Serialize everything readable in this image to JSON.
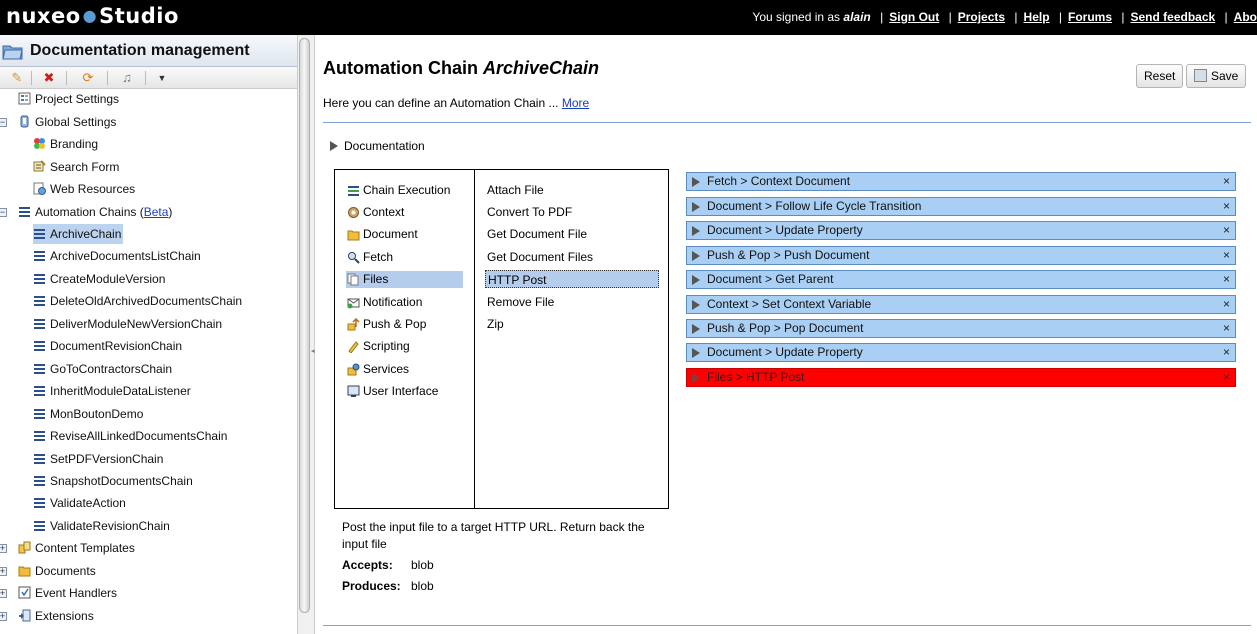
{
  "topbar": {
    "logo_left": "nuxeo",
    "logo_right": "Studio",
    "signed_in_prefix": "You signed in as",
    "username": "alain",
    "links": [
      "Sign Out",
      "Projects",
      "Help",
      "Forums",
      "Send feedback",
      "Abo"
    ]
  },
  "sidebar": {
    "title": "Documentation management",
    "toolbar": [
      "add-icon",
      "delete-icon",
      "refresh-icon",
      "rename-icon",
      "dropdown-icon"
    ],
    "tree": [
      {
        "label": "Project Settings",
        "level": 1,
        "icon": "settings-icon"
      },
      {
        "label": "Global Settings",
        "level": 1,
        "expander": "⊟",
        "icon": "globe-icon"
      },
      {
        "label": "Branding",
        "level": 2,
        "icon": "branding-icon"
      },
      {
        "label": "Search Form",
        "level": 2,
        "icon": "search-form-icon"
      },
      {
        "label": "Web Resources",
        "level": 2,
        "icon": "web-resources-icon"
      },
      {
        "label": "Automation Chains (",
        "link": "Beta",
        "suffix": ")",
        "level": 1,
        "expander": "⊟",
        "icon": "chain-icon"
      },
      {
        "label": "ArchiveChain",
        "level": 2,
        "icon": "chain-icon",
        "selected": true
      },
      {
        "label": "ArchiveDocumentsListChain",
        "level": 2,
        "icon": "chain-icon"
      },
      {
        "label": "CreateModuleVersion",
        "level": 2,
        "icon": "chain-icon"
      },
      {
        "label": "DeleteOldArchivedDocumentsChain",
        "level": 2,
        "icon": "chain-icon"
      },
      {
        "label": "DeliverModuleNewVersionChain",
        "level": 2,
        "icon": "chain-icon"
      },
      {
        "label": "DocumentRevisionChain",
        "level": 2,
        "icon": "chain-icon"
      },
      {
        "label": "GoToContractorsChain",
        "level": 2,
        "icon": "chain-icon"
      },
      {
        "label": "InheritModuleDataListener",
        "level": 2,
        "icon": "chain-icon"
      },
      {
        "label": "MonBoutonDemo",
        "level": 2,
        "icon": "chain-icon"
      },
      {
        "label": "ReviseAllLinkedDocumentsChain",
        "level": 2,
        "icon": "chain-icon"
      },
      {
        "label": "SetPDFVersionChain",
        "level": 2,
        "icon": "chain-icon"
      },
      {
        "label": "SnapshotDocumentsChain",
        "level": 2,
        "icon": "chain-icon"
      },
      {
        "label": "ValidateAction",
        "level": 2,
        "icon": "chain-icon"
      },
      {
        "label": "ValidateRevisionChain",
        "level": 2,
        "icon": "chain-icon"
      },
      {
        "label": "Content Templates",
        "level": 1,
        "expander": "⊞",
        "icon": "content-templates-icon"
      },
      {
        "label": "Documents",
        "level": 1,
        "expander": "⊞",
        "icon": "documents-icon"
      },
      {
        "label": "Event Handlers",
        "level": 1,
        "expander": "⊞",
        "icon": "event-handlers-icon"
      },
      {
        "label": "Extensions",
        "level": 1,
        "expander": "⊞",
        "icon": "extensions-icon"
      }
    ]
  },
  "main": {
    "title_prefix": "Automation Chain",
    "title_name": "ArchiveChain",
    "intro": "Here you can define an Automation Chain ...",
    "intro_link": "More",
    "reset_label": "Reset",
    "save_label": "Save",
    "section_label": "Documentation",
    "categories": [
      {
        "label": "Chain Execution",
        "icon": "chain-execution-icon"
      },
      {
        "label": "Context",
        "icon": "context-icon"
      },
      {
        "label": "Document",
        "icon": "document-icon"
      },
      {
        "label": "Fetch",
        "icon": "fetch-icon"
      },
      {
        "label": "Files",
        "icon": "files-icon",
        "selected": true
      },
      {
        "label": "Notification",
        "icon": "notification-icon"
      },
      {
        "label": "Push & Pop",
        "icon": "push-pop-icon"
      },
      {
        "label": "Scripting",
        "icon": "scripting-icon"
      },
      {
        "label": "Services",
        "icon": "services-icon"
      },
      {
        "label": "User Interface",
        "icon": "user-interface-icon"
      }
    ],
    "operations": [
      {
        "label": "Attach File"
      },
      {
        "label": "Convert To PDF"
      },
      {
        "label": "Get Document File"
      },
      {
        "label": "Get Document Files"
      },
      {
        "label": "HTTP Post",
        "selected": true
      },
      {
        "label": "Remove File"
      },
      {
        "label": "Zip"
      }
    ],
    "op_description": "Post the input file to a target HTTP URL. Return back the input file",
    "accepts_label": "Accepts:",
    "accepts_value": "blob",
    "produces_label": "Produces:",
    "produces_value": "blob",
    "chain": [
      {
        "label": "Fetch > Context Document"
      },
      {
        "label": "Document > Follow Life Cycle Transition"
      },
      {
        "label": "Document > Update Property"
      },
      {
        "label": "Push & Pop > Push Document"
      },
      {
        "label": "Document > Get Parent"
      },
      {
        "label": "Context > Set Context Variable"
      },
      {
        "label": "Push & Pop > Pop Document"
      },
      {
        "label": "Document > Update Property"
      },
      {
        "label": "Files > HTTP Post",
        "error": true
      }
    ],
    "remove_glyph": "×"
  },
  "colors": {
    "topbar_bg": "#000000",
    "chain_item_bg": "#a9cff5",
    "chain_error_bg": "#ff0000",
    "selection_bg": "#b4cdec",
    "link": "#1a3fbf"
  }
}
